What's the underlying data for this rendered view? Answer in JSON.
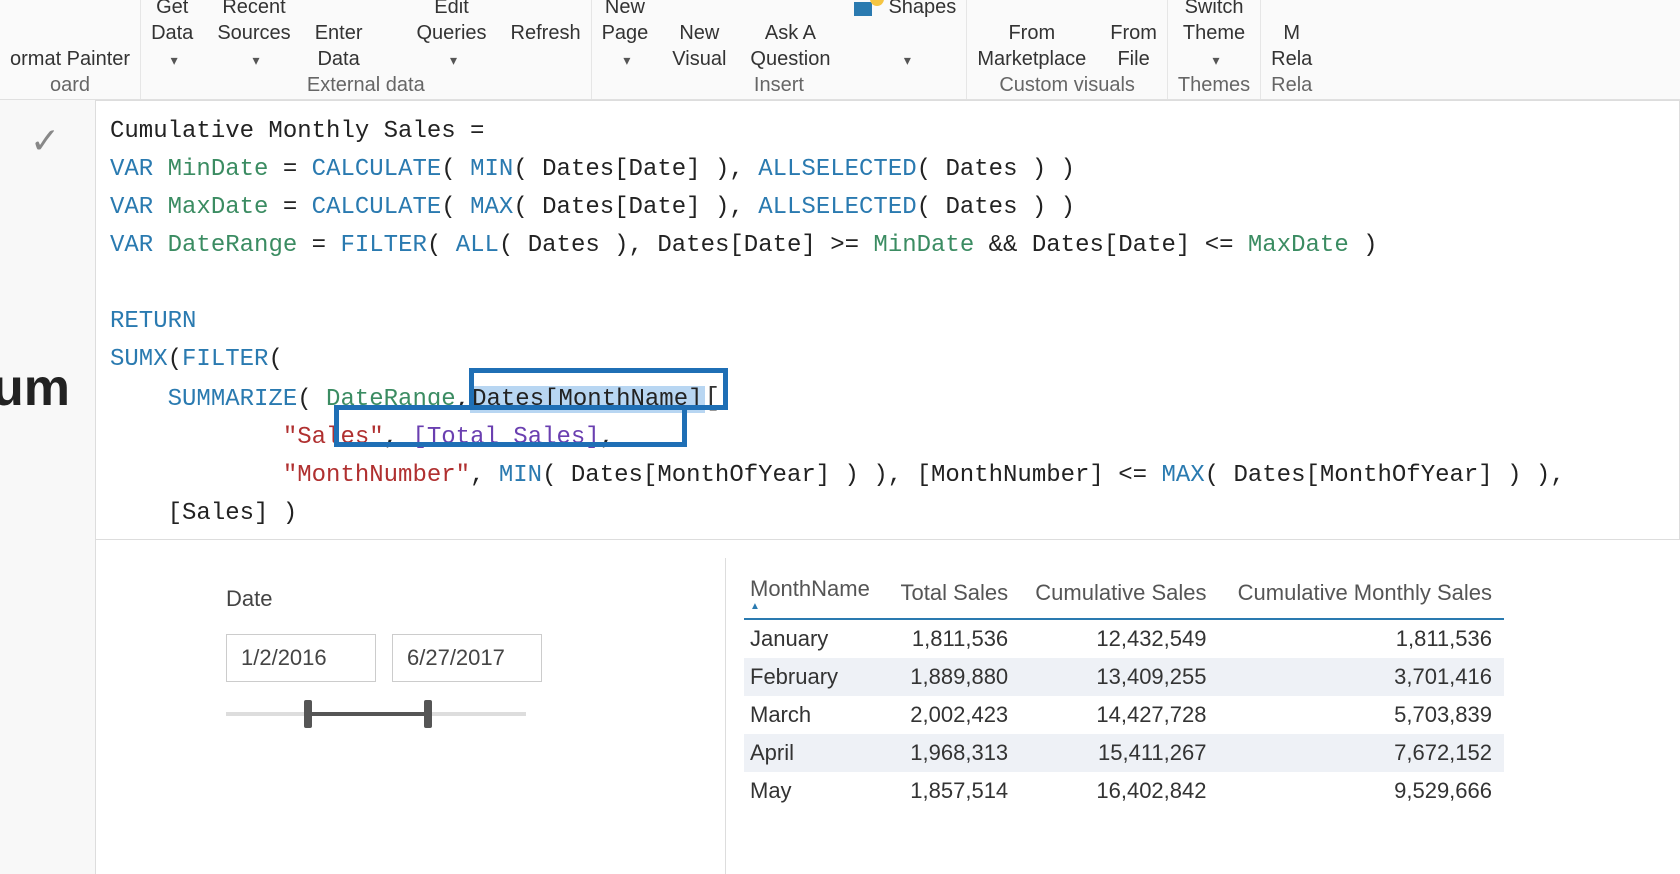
{
  "ribbon": {
    "clipboard": {
      "format_painter": "ormat Painter",
      "group_label": "oard"
    },
    "external_data": {
      "get_data": "Get",
      "get_data2": "Data",
      "recent": "Recent",
      "recent2": "Sources",
      "enter": "Enter",
      "enter2": "Data",
      "edit": "Edit",
      "edit2": "Queries",
      "refresh": "Refresh",
      "group_label": "External data"
    },
    "insert": {
      "new_page": "New",
      "new_page2": "Page",
      "new_visual": "New",
      "new_visual2": "Visual",
      "ask": "Ask A",
      "ask2": "Question",
      "shapes": "Shapes",
      "group_label": "Insert"
    },
    "custom_visuals": {
      "marketplace": "From",
      "marketplace2": "Marketplace",
      "file": "From",
      "file2": "File",
      "group_label": "Custom visuals"
    },
    "themes": {
      "switch": "Switch",
      "switch2": "Theme",
      "group_label": "Themes"
    },
    "relationships": {
      "manage": "M",
      "manage2": "Rela",
      "group_label": "Rela"
    }
  },
  "partial": {
    "cum": "um",
    "board": ""
  },
  "formula": {
    "line1a": "Cumulative Monthly Sales =",
    "var": "VAR",
    "mindate": "MinDate",
    "maxdate": "MaxDate",
    "daterange": "DateRange",
    "eq": " = ",
    "calc": "CALCULATE",
    "lp": "( ",
    "rp": " )",
    "min": "MIN",
    "max": "MAX",
    "datescol": "Dates[Date]",
    "comma": ", ",
    "allsel": "ALLSELECTED",
    "datestbl": "Dates",
    "filter": "FILTER",
    "all": "ALL",
    "ge": " >= ",
    "and": " && ",
    "le": " <= ",
    "return": "RETURN",
    "sumx": "SUMX",
    "summarize": "SUMMARIZE",
    "daterange_ref": "DateRange",
    "monthname_col": "Dates[MonthName]",
    "sales_str": "\"Sales\"",
    "total_sales": "[Total Sales]",
    "monthnum_str": "\"MonthNumber\"",
    "monthofyear": "Dates[MonthOfYear]",
    "monthnum_ref": "[MonthNumber]",
    "sales_ref": "[Sales]",
    "close": " )"
  },
  "slicer": {
    "title": "Date",
    "start": "1/2/2016",
    "end": "6/27/2017"
  },
  "table": {
    "headers": {
      "month": "MonthName",
      "total": "Total Sales",
      "cum": "Cumulative Sales",
      "cumm": "Cumulative Monthly Sales"
    },
    "rows": [
      {
        "month": "January",
        "total": "1,811,536",
        "cum": "12,432,549",
        "cumm": "1,811,536"
      },
      {
        "month": "February",
        "total": "1,889,880",
        "cum": "13,409,255",
        "cumm": "3,701,416"
      },
      {
        "month": "March",
        "total": "2,002,423",
        "cum": "14,427,728",
        "cumm": "5,703,839"
      },
      {
        "month": "April",
        "total": "1,968,313",
        "cum": "15,411,267",
        "cumm": "7,672,152"
      },
      {
        "month": "May",
        "total": "1,857,514",
        "cum": "16,402,842",
        "cumm": "9,529,666"
      }
    ]
  },
  "chart_data": {
    "type": "table",
    "title": "Cumulative Monthly Sales",
    "columns": [
      "MonthName",
      "Total Sales",
      "Cumulative Sales",
      "Cumulative Monthly Sales"
    ],
    "rows": [
      [
        "January",
        1811536,
        12432549,
        1811536
      ],
      [
        "February",
        1889880,
        13409255,
        3701416
      ],
      [
        "March",
        2002423,
        14427728,
        5703839
      ],
      [
        "April",
        1968313,
        15411267,
        7672152
      ],
      [
        "May",
        1857514,
        16402842,
        9529666
      ]
    ],
    "slicer_range": [
      "2016-01-02",
      "2017-06-27"
    ]
  }
}
